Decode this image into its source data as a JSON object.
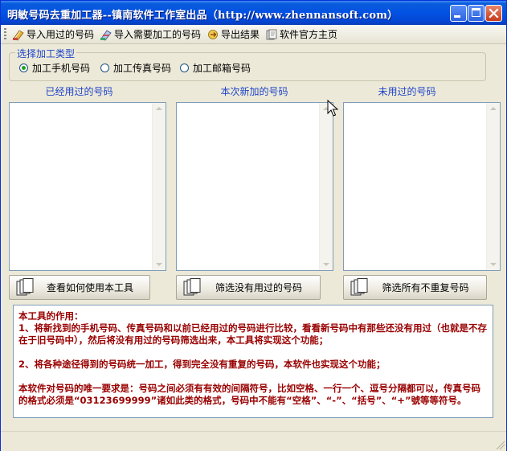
{
  "window": {
    "title": "明敏号码去重加工器--镇南软件工作室出品（http://www.zhennansoft.com）"
  },
  "toolbar": {
    "items": [
      {
        "label": "导入用过的号码",
        "icon": "import-used-icon"
      },
      {
        "label": "导入需要加工的号码",
        "icon": "import-new-icon"
      },
      {
        "label": "导出结果",
        "icon": "export-icon"
      },
      {
        "label": "软件官方主页",
        "icon": "homepage-icon"
      }
    ]
  },
  "type_group": {
    "legend": "选择加工类型",
    "options": [
      {
        "label": "加工手机号码",
        "checked": true
      },
      {
        "label": "加工传真号码",
        "checked": false
      },
      {
        "label": "加工邮箱号码",
        "checked": false
      }
    ]
  },
  "columns": [
    {
      "label": "已经用过的号码"
    },
    {
      "label": "本次新加的号码"
    },
    {
      "label": "未用过的号码"
    }
  ],
  "actions": [
    {
      "label": "查看如何使用本工具"
    },
    {
      "label": "筛选没有用过的号码"
    },
    {
      "label": "筛选所有不重复号码"
    }
  ],
  "info": {
    "heading": "本工具的作用：",
    "p1": "1、将新找到的手机号码、传真号码和以前已经用过的号码进行比较，看看新号码中有那些还没有用过（也就是不存在于旧号码中），然后将没有用过的号码筛选出来，本工具将实现这个功能；",
    "p2": "2、将各种途径得到的号码统一加工，得到完全没有重复的号码，本软件也实现这个功能；",
    "p3": "本软件对号码的唯一要求是：号码之间必须有有效的间隔符号，比如空格、一行一个、逗号分隔都可以，传真号码的格式必须是“03123699999”诸如此类的格式，号码中不能有“空格”、“-”、“括号”、“+”號等等符号。"
  },
  "colors": {
    "titlebar": "#0352E3",
    "label_blue": "#1F44C9",
    "info_text": "#990000",
    "window_bg": "#ECE9D8"
  }
}
